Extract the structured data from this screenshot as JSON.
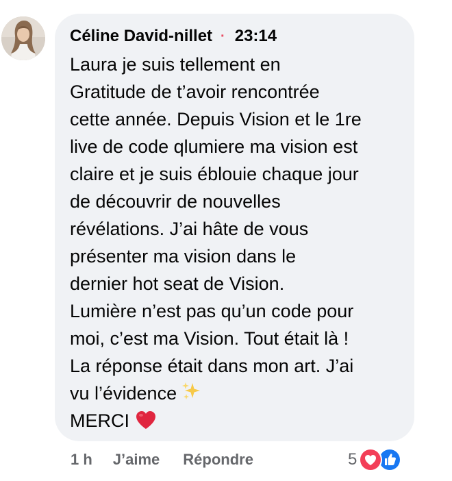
{
  "comment": {
    "author": "Céline David-nillet",
    "separator": "·",
    "timestamp": "23:14",
    "lines": [
      "Laura je suis tellement en",
      "Gratitude de t’avoir rencontrée",
      "cette année. Depuis Vision et le 1re",
      "live de code qlumiere ma vision est",
      "claire et je suis éblouie chaque jour",
      "de découvrir de nouvelles",
      "révélations. J’ai hâte de vous",
      "présenter ma vision dans le",
      "dernier hot seat de Vision.",
      "Lumière n’est pas qu’un code pour",
      "moi, c’est ma Vision. Tout était là !",
      "La réponse était dans mon art. J’ai",
      "vu l’évidence",
      "MERCI"
    ],
    "emoji": {
      "sparkles": "sparkles-icon",
      "heart": "red-heart-icon"
    }
  },
  "actions": {
    "age": "1 h",
    "like_label": "J’aime",
    "reply_label": "Répondre"
  },
  "reactions": {
    "count": "5",
    "types": [
      "love-reaction-icon",
      "like-reaction-icon"
    ]
  },
  "colors": {
    "bubble": "#f0f2f5",
    "text": "#050505",
    "secondary": "#65676b",
    "dot": "#e94b62",
    "love": "#f33e58",
    "like": "#1877f2"
  }
}
